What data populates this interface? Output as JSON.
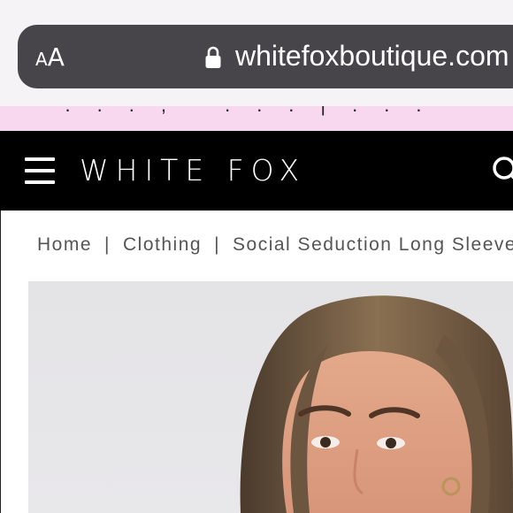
{
  "browser": {
    "text_size_label_small": "A",
    "text_size_label_large": "A",
    "url": "whitefoxboutique.com",
    "lock_icon": "lock-icon"
  },
  "promo": {
    "text": "..., ...|..."
  },
  "header": {
    "menu_icon": "hamburger-icon",
    "logo": "WHITE FOX",
    "search_icon": "search-icon"
  },
  "breadcrumb": {
    "items": [
      "Home",
      "Clothing",
      "Social Seduction Long Sleeve"
    ],
    "separator": "|"
  },
  "product": {
    "image": "product-model-photo"
  },
  "colors": {
    "browser_bg": "#f5f3f5",
    "url_pill": "#48454a",
    "promo_bg": "#f8d8ef",
    "header_bg": "#000000"
  }
}
